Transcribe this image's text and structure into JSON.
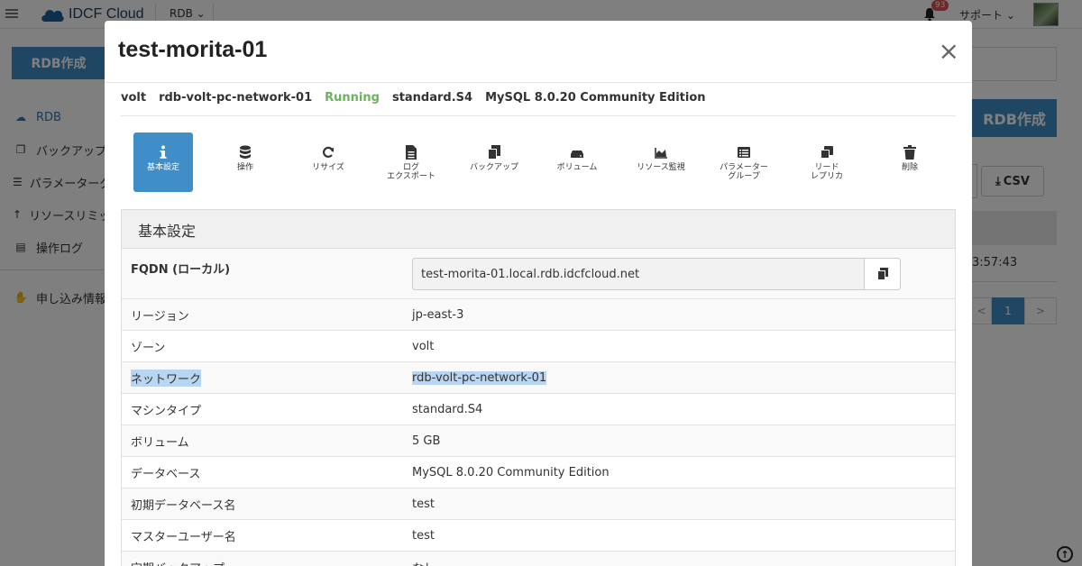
{
  "app": {
    "logo_text": "IDCF Cloud",
    "service_menu": "RDB",
    "notification_count": "93",
    "support_label": "サポート"
  },
  "sidebar": {
    "create_button": "RDB作成",
    "items": [
      {
        "label": "RDB",
        "icon": "cloud-icon"
      },
      {
        "label": "バックアップ",
        "icon": "copy-icon"
      },
      {
        "label": "パラメーターグ",
        "icon": "list-icon"
      },
      {
        "label": "リソースリミッ",
        "icon": "arrow-up-icon"
      },
      {
        "label": "操作ログ",
        "icon": "file-icon"
      },
      {
        "label": "申し込み情報",
        "icon": "handshake-icon"
      }
    ]
  },
  "background_content": {
    "create_button": "RDB作成",
    "csv_button": "CSV",
    "time_text": "3:57:43",
    "pager": {
      "prev": "<",
      "current": "1",
      "next": ">"
    }
  },
  "modal": {
    "title": "test-morita-01",
    "close_label": "×",
    "summary": {
      "zone": "volt",
      "network": "rdb-volt-pc-network-01",
      "status": "Running",
      "machine_type": "standard.S4",
      "database": "MySQL 8.0.20 Community Edition"
    },
    "actions": [
      {
        "label": "基本設定",
        "icon": "info-icon",
        "active": true
      },
      {
        "label": "操作",
        "icon": "database-icon",
        "active": false
      },
      {
        "label": "リサイズ",
        "icon": "refresh-icon",
        "active": false
      },
      {
        "label": "ログ\nエクスポート",
        "icon": "file-icon",
        "active": false
      },
      {
        "label": "バックアップ",
        "icon": "copy-icon",
        "active": false
      },
      {
        "label": "ボリューム",
        "icon": "hdd-icon",
        "active": false
      },
      {
        "label": "リソース監視",
        "icon": "area-chart-icon",
        "active": false
      },
      {
        "label": "パラメーター\nグループ",
        "icon": "list-alt-icon",
        "active": false
      },
      {
        "label": "リード\nレプリカ",
        "icon": "clone-icon",
        "active": false
      },
      {
        "label": "削除",
        "icon": "trash-icon",
        "active": false
      }
    ],
    "panel_title": "基本設定",
    "fqdn_label": "FQDN (ローカル)",
    "fqdn_value": "test-morita-01.local.rdb.idcfcloud.net",
    "rows": [
      {
        "key": "リージョン",
        "value": "jp-east-3"
      },
      {
        "key": "ゾーン",
        "value": "volt"
      },
      {
        "key": "ネットワーク",
        "value": "rdb-volt-pc-network-01"
      },
      {
        "key": "マシンタイプ",
        "value": "standard.S4"
      },
      {
        "key": "ボリューム",
        "value": "5 GB"
      },
      {
        "key": "データベース",
        "value": "MySQL 8.0.20 Community Edition"
      },
      {
        "key": "初期データベース名",
        "value": "test"
      },
      {
        "key": "マスターユーザー名",
        "value": "test"
      },
      {
        "key": "定期バックアップ",
        "value": "なし"
      }
    ]
  },
  "colors": {
    "accent": "#3f8ec7",
    "running": "#6bb35a",
    "selection": "#b8d5f2"
  }
}
